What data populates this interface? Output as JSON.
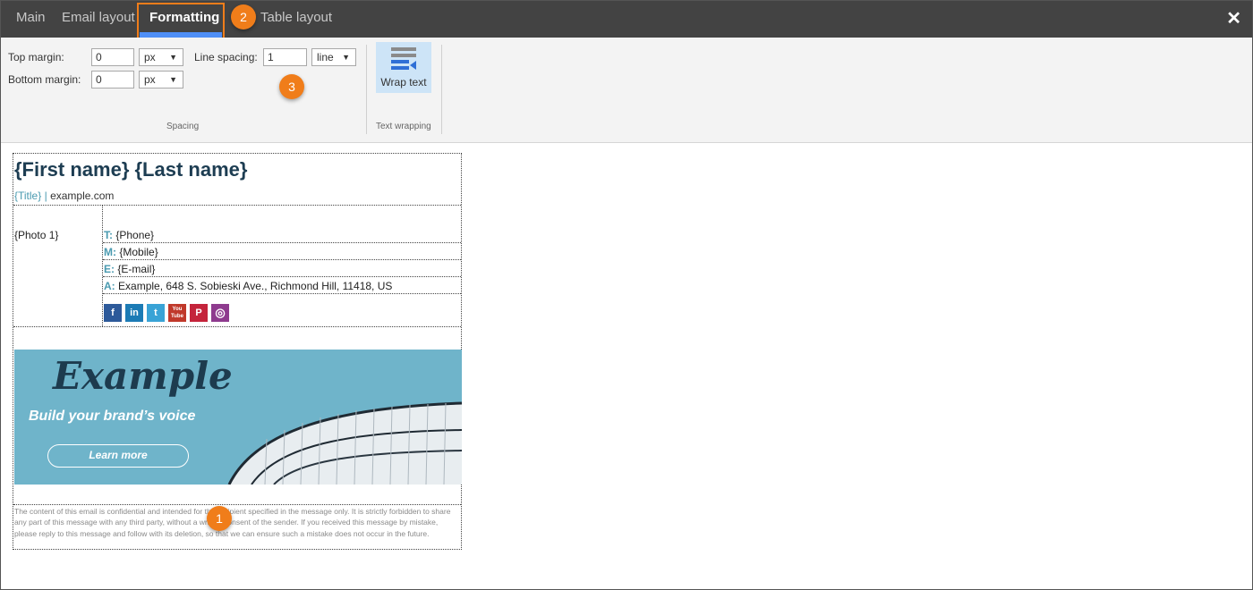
{
  "tabs": {
    "main": "Main",
    "email_layout": "Email layout",
    "formatting": "Formatting",
    "table_layout": "Table layout",
    "close_glyph": "✕"
  },
  "badges": {
    "one": "1",
    "two": "2",
    "three": "3"
  },
  "ribbon": {
    "top_margin_label": "Top margin:",
    "top_margin_value": "0",
    "top_margin_unit": "px",
    "bottom_margin_label": "Bottom margin:",
    "bottom_margin_value": "0",
    "bottom_margin_unit": "px",
    "line_spacing_label": "Line spacing:",
    "line_spacing_value": "1",
    "line_spacing_unit": "line",
    "spacing_group": "Spacing",
    "wrap_text": "Wrap text",
    "text_wrapping_group": "Text wrapping"
  },
  "signature": {
    "name": "{First name} {Last name}",
    "title": "{Title}",
    "separator": "|",
    "website": "example.com",
    "photo": "{Photo 1}",
    "phone_key": "T:",
    "phone": "{Phone}",
    "mobile_key": "M:",
    "mobile": "{Mobile}",
    "email_key": "E:",
    "email": "{E-mail}",
    "address_key": "A:",
    "address": "Example, 648 S. Sobieski Ave., Richmond Hill, 11418, US",
    "social": [
      "f",
      "in",
      "t",
      "You Tube",
      "P",
      "◎"
    ],
    "banner_brand": "Example",
    "banner_tagline": "Build your brand’s voice",
    "banner_button": "Learn more",
    "disclaimer": "The content of this email is confidential and intended for the recipient specified in the message only. It is strictly forbidden to share any part of this message with any third party, without a written consent of the sender. If you received this message by mistake, please reply to this message and follow with its deletion, so that we can ensure such a mistake does not occur in the future."
  },
  "colors": {
    "accent_orange": "#f07d1a",
    "tab_underline": "#4f8ff7",
    "facebook": "#2d5a9a",
    "linkedin": "#1c7bb5",
    "twitter": "#39a3d6",
    "youtube": "#c0392b",
    "pinterest": "#c4243b",
    "instagram": "#8e3a8e"
  }
}
